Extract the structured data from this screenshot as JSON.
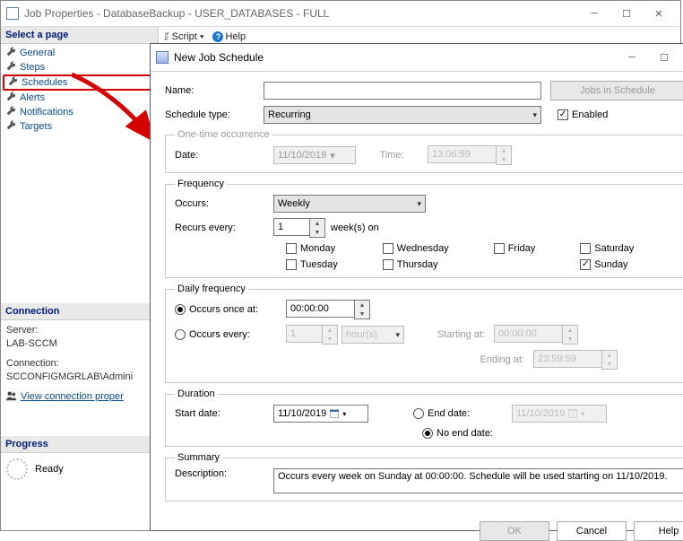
{
  "jobprop": {
    "title": "Job Properties - DatabaseBackup - USER_DATABASES - FULL",
    "select_page": "Select a page",
    "nav": [
      "General",
      "Steps",
      "Schedules",
      "Alerts",
      "Notifications",
      "Targets"
    ],
    "toolbar": {
      "script": "Script",
      "help": "Help"
    },
    "connection": {
      "header": "Connection",
      "server_lab": "Server:",
      "server": "LAB-SCCM",
      "conn_lab": "Connection:",
      "conn": "SCCONFIGMGRLAB\\Admini",
      "link": "View connection proper"
    },
    "progress": {
      "header": "Progress",
      "status": "Ready"
    }
  },
  "sched": {
    "title": "New Job Schedule",
    "name_lab": "Name:",
    "name_val": "",
    "jobs_btn": "Jobs in Schedule",
    "type_lab": "Schedule type:",
    "type_val": "Recurring",
    "enabled": "Enabled",
    "onetime": {
      "legend": "One-time occurrence",
      "date_lab": "Date:",
      "date": "11/10/2019",
      "time_lab": "Time:",
      "time": "13:06:59"
    },
    "freq": {
      "legend": "Frequency",
      "occurs_lab": "Occurs:",
      "occurs": "Weekly",
      "recur_lab": "Recurs every:",
      "recur_n": "1",
      "recur_unit": "week(s) on",
      "days": {
        "mon": "Monday",
        "tue": "Tuesday",
        "wed": "Wednesday",
        "thu": "Thursday",
        "fri": "Friday",
        "sat": "Saturday",
        "sun": "Sunday"
      }
    },
    "daily": {
      "legend": "Daily frequency",
      "once_lab": "Occurs once at:",
      "once_val": "00:00:00",
      "every_lab": "Occurs every:",
      "every_n": "1",
      "every_unit": "hour(s)",
      "start_lab": "Starting at:",
      "start_val": "00:00:00",
      "end_lab": "Ending at:",
      "end_val": "23:59:59"
    },
    "dur": {
      "legend": "Duration",
      "start_lab": "Start date:",
      "start": "11/10/2019",
      "end_lab": "End date:",
      "end": "11/10/2019",
      "noend": "No end date:"
    },
    "summary": {
      "legend": "Summary",
      "desc_lab": "Description:",
      "desc": "Occurs every week on Sunday at 00:00:00. Schedule will be used starting on 11/10/2019."
    },
    "buttons": {
      "ok": "OK",
      "cancel": "Cancel",
      "help": "Help"
    }
  }
}
